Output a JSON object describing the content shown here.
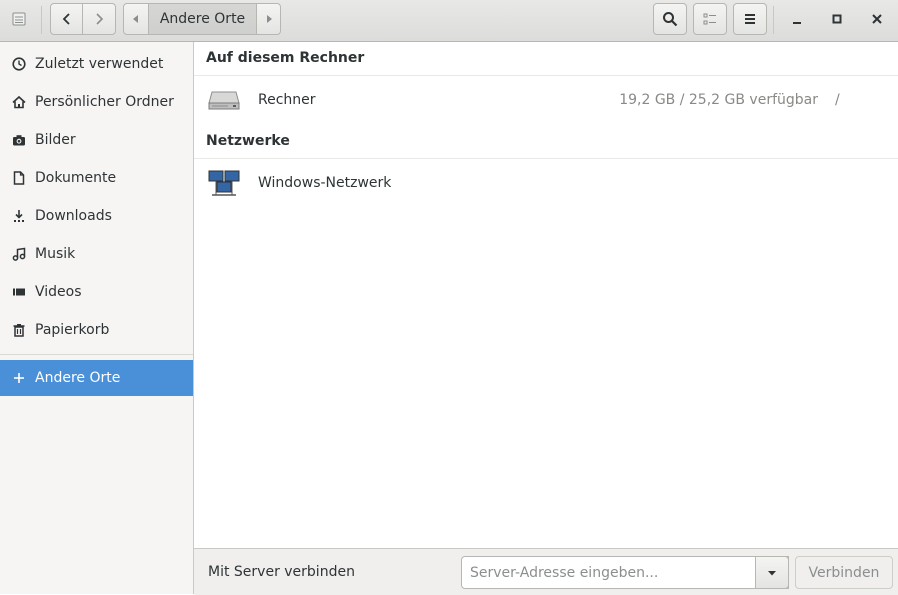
{
  "header": {
    "path_label": "Andere Orte"
  },
  "sidebar": {
    "items": [
      {
        "label": "Zuletzt verwendet",
        "icon": "clock-icon"
      },
      {
        "label": "Persönlicher Ordner",
        "icon": "home-icon"
      },
      {
        "label": "Bilder",
        "icon": "camera-icon"
      },
      {
        "label": "Dokumente",
        "icon": "document-icon"
      },
      {
        "label": "Downloads",
        "icon": "download-icon"
      },
      {
        "label": "Musik",
        "icon": "music-icon"
      },
      {
        "label": "Videos",
        "icon": "video-icon"
      },
      {
        "label": "Papierkorb",
        "icon": "trash-icon"
      }
    ],
    "other": {
      "label": "Andere Orte",
      "icon": "plus-icon"
    }
  },
  "main": {
    "local_title": "Auf diesem Rechner",
    "computer": {
      "name": "Rechner",
      "info": "19,2 GB / 25,2 GB verfügbar",
      "path": "/"
    },
    "networks_title": "Netzwerke",
    "network": {
      "name": "Windows-Netzwerk"
    }
  },
  "actionbar": {
    "label": "Mit Server verbinden",
    "placeholder": "Server-Adresse eingeben...",
    "connect_label": "Verbinden"
  },
  "colors": {
    "accent": "#4a90d9"
  }
}
